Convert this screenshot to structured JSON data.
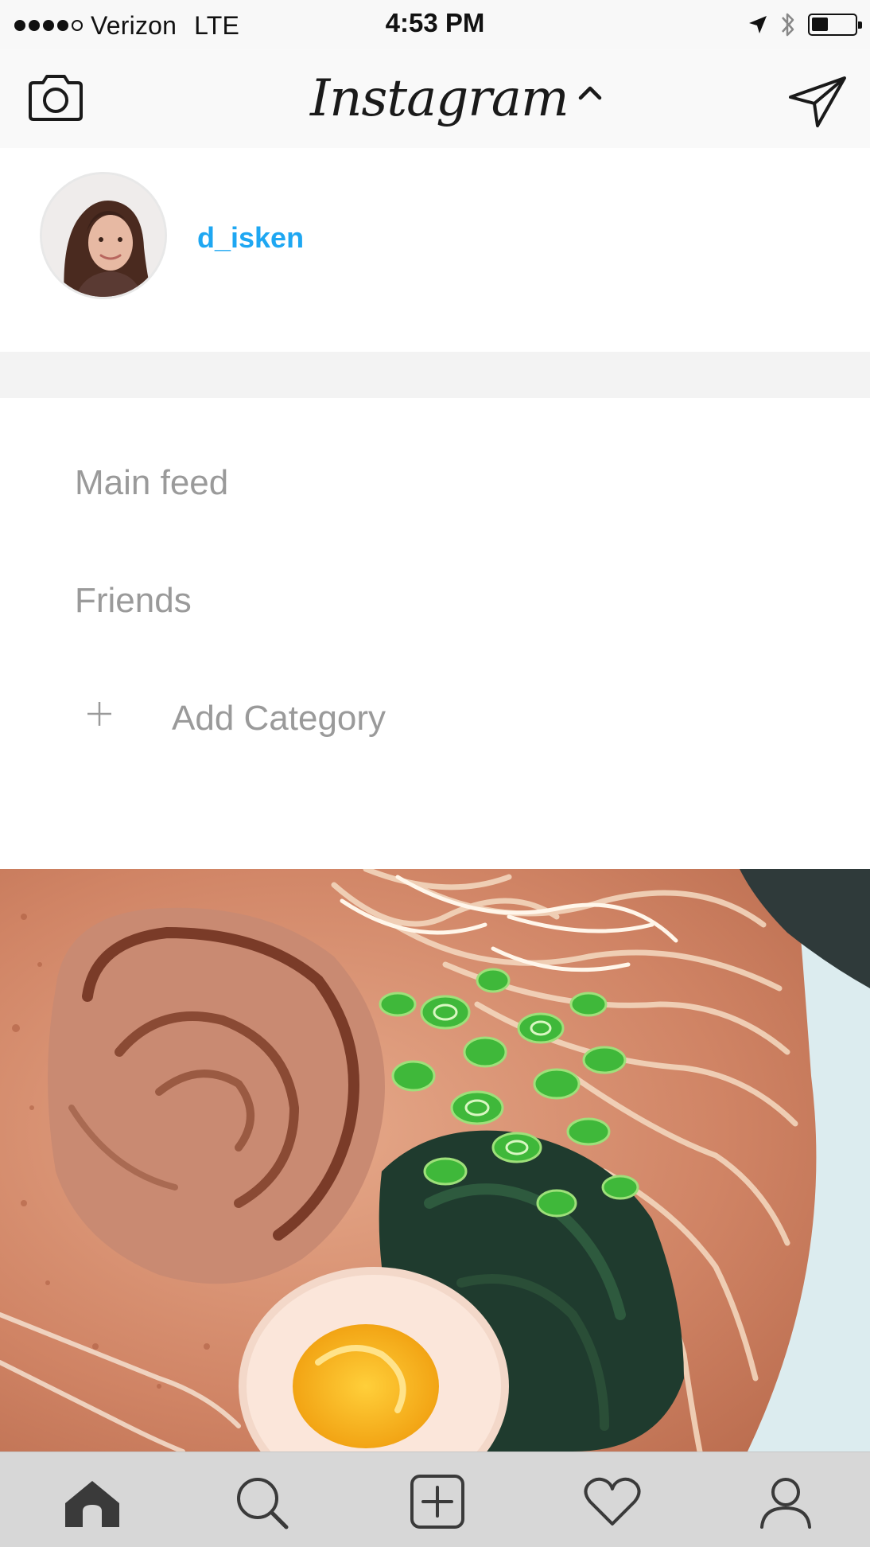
{
  "status_bar": {
    "carrier": "Verizon",
    "network": "LTE",
    "time": "4:53 PM",
    "signal_bars_filled": 4,
    "signal_bars_total": 5,
    "battery_level": 0.4
  },
  "nav": {
    "logo": "Instagram",
    "camera_icon": "camera-icon",
    "caret_icon": "chevron-up-icon",
    "send_icon": "paper-plane-icon"
  },
  "profile": {
    "username": "d_isken",
    "username_color": "#1ea7f2"
  },
  "categories": {
    "items": [
      "Main feed",
      "Friends"
    ],
    "add_label": "Add Category",
    "add_icon": "plus-icon"
  },
  "tab_bar": {
    "tabs": [
      "home-icon",
      "search-icon",
      "new-post-icon",
      "heart-icon",
      "profile-icon"
    ],
    "active": "home-icon"
  }
}
